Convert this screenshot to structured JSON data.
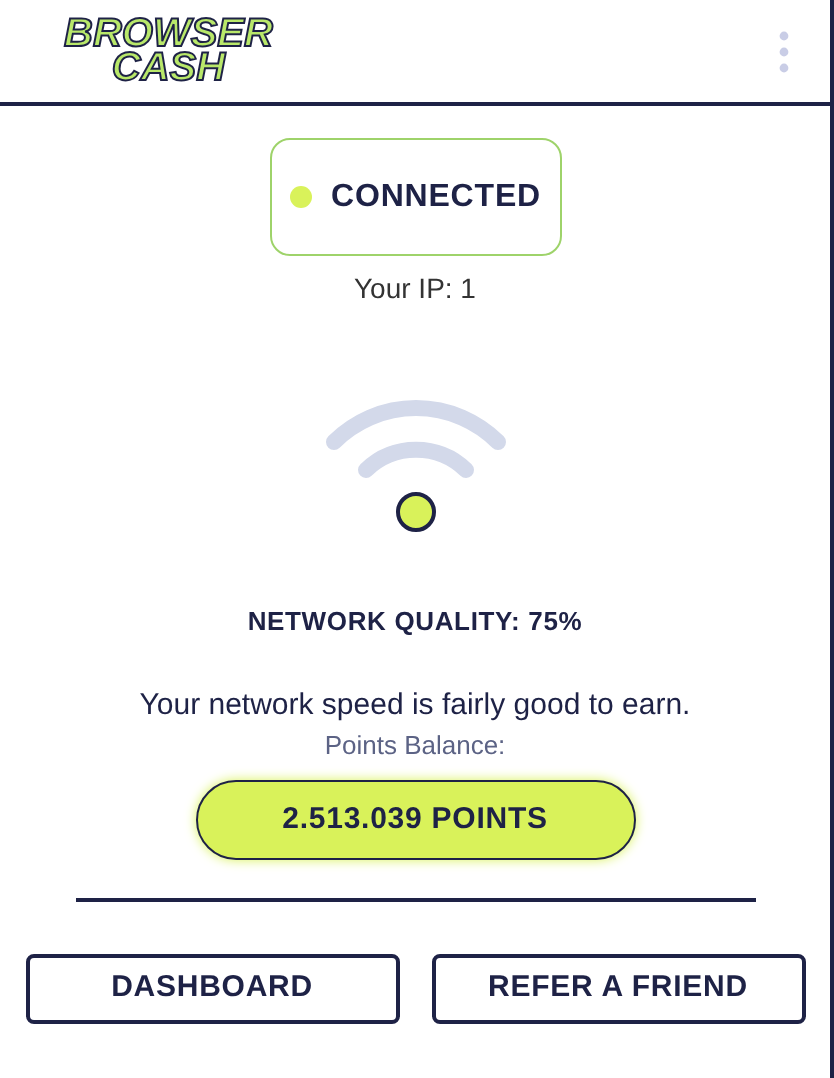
{
  "logo": {
    "lines": [
      "BROWSER",
      "CASH"
    ]
  },
  "status": {
    "label": "CONNECTED",
    "connected": true
  },
  "ip_label": "Your IP: 1",
  "quality": "NETWORK QUALITY: 75%",
  "message": "Your network speed is fairly good to earn.",
  "balance_label": "Points Balance:",
  "balance": "2.513.039 POINTS",
  "buttons": [
    "DASHBOARD",
    "REFER A FRIEND"
  ]
}
